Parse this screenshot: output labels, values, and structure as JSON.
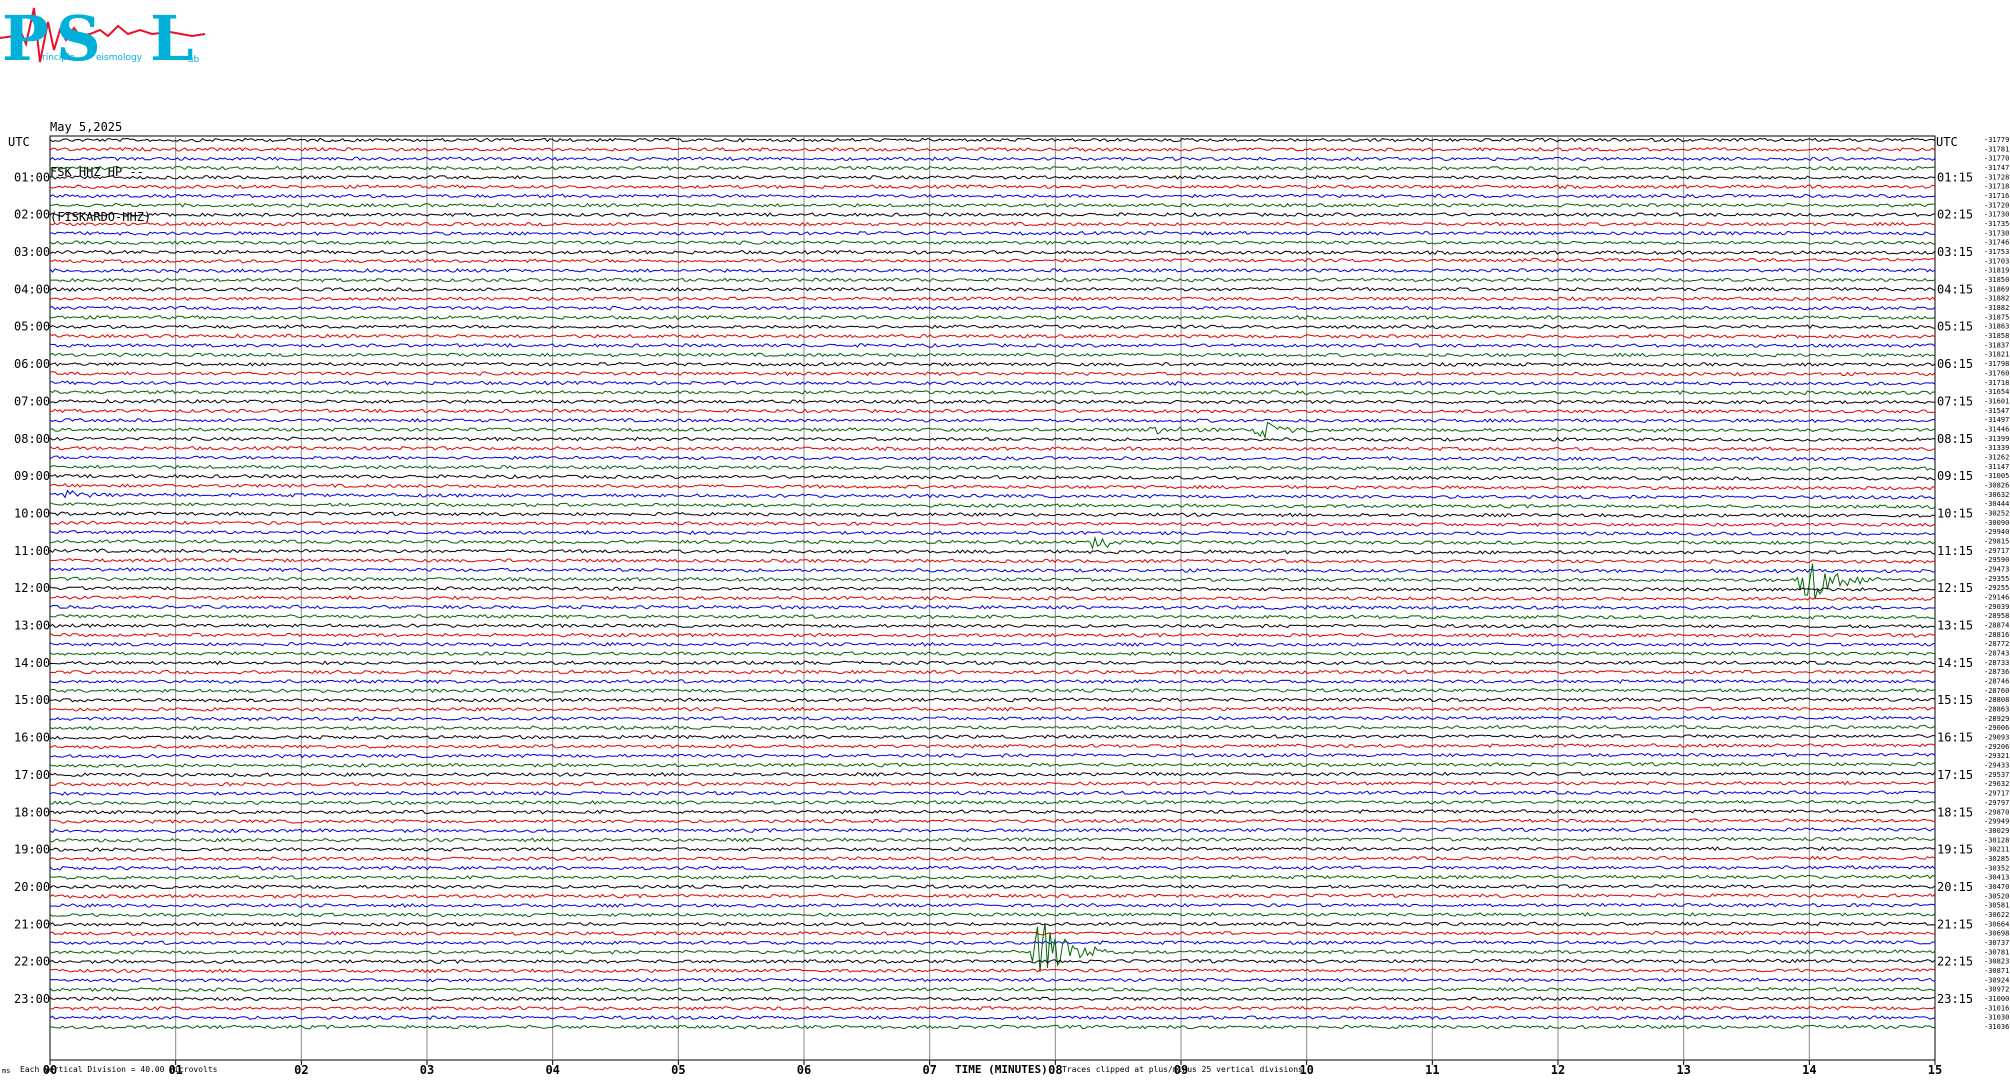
{
  "logo": {
    "big_letters": [
      "P",
      "S",
      "L"
    ],
    "small_words": [
      "rincipia",
      "eismology",
      "ab"
    ],
    "colors": {
      "letters": "#00b0d8",
      "trace": "#e8102a"
    }
  },
  "header": {
    "date": "May 5,2025",
    "channel": "FSK HHZ HP --",
    "station": "(FISKARDO-HHZ)"
  },
  "chart_data": {
    "type": "line",
    "left_axis_title": "UTC",
    "right_axis_title": "UTC",
    "xlabel": "TIME (MINUTES)",
    "x_ticks": [
      "00",
      "01",
      "02",
      "03",
      "04",
      "05",
      "06",
      "07",
      "08",
      "09",
      "10",
      "11",
      "12",
      "13",
      "14",
      "15"
    ],
    "xlim": [
      0,
      15
    ],
    "left_hour_labels": [
      "01:00",
      "02:00",
      "03:00",
      "04:00",
      "05:00",
      "06:00",
      "07:00",
      "08:00",
      "09:00",
      "10:00",
      "11:00",
      "12:00",
      "13:00",
      "14:00",
      "15:00",
      "16:00",
      "17:00",
      "18:00",
      "19:00",
      "20:00",
      "21:00",
      "22:00",
      "23:00"
    ],
    "right_hour_labels": [
      "01:15",
      "02:15",
      "03:15",
      "04:15",
      "05:15",
      "06:15",
      "07:15",
      "08:15",
      "09:15",
      "10:15",
      "11:15",
      "12:15",
      "13:15",
      "14:15",
      "15:15",
      "16:15",
      "17:15",
      "18:15",
      "19:15",
      "20:15",
      "21:15",
      "22:15",
      "23:15"
    ],
    "trace_colors": [
      "#000000",
      "#e00000",
      "#0000e0",
      "#006400"
    ],
    "trace_count": 96,
    "trace_minutes": 15,
    "grid": true,
    "offsets": [
      -31779,
      -31781,
      -31770,
      -31747,
      -31728,
      -31718,
      -31716,
      -31720,
      -31730,
      -31735,
      -31730,
      -31746,
      -31753,
      -31703,
      -31819,
      -31850,
      -31869,
      -31882,
      -31882,
      -31875,
      -31863,
      -31858,
      -31837,
      -31821,
      -31798,
      -31760,
      -31718,
      -31654,
      -31601,
      -31547,
      -31497,
      -31446,
      -31399,
      -31339,
      -31262,
      -31147,
      -31005,
      -30826,
      -30632,
      -30444,
      -30252,
      -30090,
      -29940,
      -29815,
      -29717,
      -29590,
      -29473,
      -29355,
      -29255,
      -29146,
      -29039,
      -28958,
      -28874,
      -28816,
      -28772,
      -28743,
      -28733,
      -28736,
      -28746,
      -28760,
      -28808,
      -28863,
      -28929,
      -29006,
      -29093,
      -29206,
      -29321,
      -29433,
      -29537,
      -29632,
      -29717,
      -29797,
      -29870,
      -29949,
      -30029,
      -30128,
      -30211,
      -30285,
      -30352,
      -30413,
      -30470,
      -30520,
      -30581,
      -30622,
      -30664,
      -30698,
      -30737,
      -30781,
      -30823,
      -30871,
      -30924,
      -30972,
      -31000,
      -31016,
      -31030,
      -31036
    ],
    "events": [
      {
        "trace": 31,
        "minute": 9.62,
        "amplitude": 9
      },
      {
        "trace": 31,
        "minute": 8.77,
        "amplitude": 4
      },
      {
        "trace": 43,
        "minute": 8.3,
        "amplitude": 8
      },
      {
        "trace": 47,
        "minute": 13.95,
        "amplitude": 34
      },
      {
        "trace": 87,
        "minute": 7.85,
        "amplitude": 40
      },
      {
        "trace": 38,
        "minute": 0.12,
        "amplitude": 5
      },
      {
        "trace": 31,
        "minute": 12.55,
        "amplitude": 3
      }
    ],
    "footer": {
      "left_prefix": "ms",
      "vertical_division": "Each Vertical Division =    40.00 microvolts",
      "clipping_note": "Traces clipped at plus/minus 25 vertical divisions"
    }
  }
}
